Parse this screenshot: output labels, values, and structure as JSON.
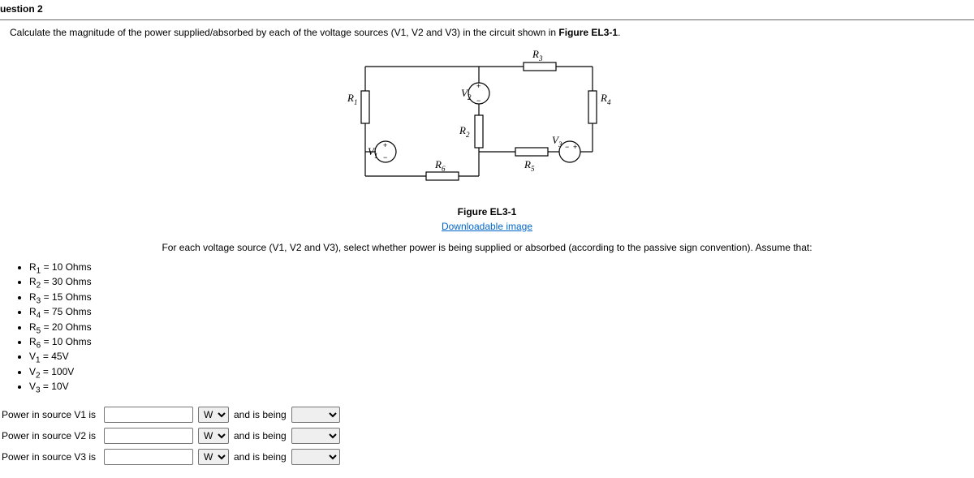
{
  "question": {
    "title": "uestion 2",
    "prompt_pre": "Calculate the magnitude of the power supplied/absorbed by each of the voltage sources (V1, V2 and V3) in the circuit shown in ",
    "prompt_bold": "Figure EL3-1",
    "prompt_post": "."
  },
  "figure": {
    "caption": "Figure EL3-1",
    "link": "Downloadable image",
    "labels": {
      "R1": "R",
      "R1s": "1",
      "R2": "R",
      "R2s": "2",
      "R3": "R",
      "R3s": "3",
      "R4": "R",
      "R4s": "4",
      "R5": "R",
      "R5s": "5",
      "R6": "R",
      "R6s": "6",
      "V1": "V",
      "V1s": "1",
      "V2": "V",
      "V2s": "2",
      "V3": "V",
      "V3s": "3"
    }
  },
  "subprompt": "For each voltage source (V1, V2 and V3), select whether power is being supplied or absorbed (according to the passive sign convention).  Assume that:",
  "givens": [
    "R1 = 10 Ohms",
    "R2 = 30 Ohms",
    "R3 = 15 Ohms",
    "R4 = 75 Ohms",
    "R5 = 20 Ohms",
    "R6 = 10 Ohms",
    "V1 = 45V",
    "V2 = 100V",
    "V3 = 10V"
  ],
  "rows": [
    {
      "label": "Power in source V1 is",
      "unit": "W",
      "conj": "and is being"
    },
    {
      "label": "Power in source V2 is",
      "unit": "W",
      "conj": "and is being"
    },
    {
      "label": "Power in source V3 is",
      "unit": "W",
      "conj": "and is being"
    }
  ]
}
